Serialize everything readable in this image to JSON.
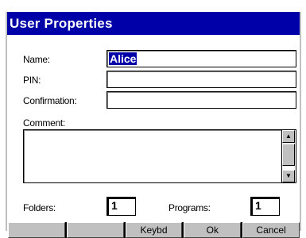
{
  "window": {
    "title": "User Properties"
  },
  "form": {
    "name_label": "Name:",
    "name_value": "Alice",
    "pin_label": "PIN:",
    "pin_value": "",
    "confirmation_label": "Confirmation:",
    "confirmation_value": "",
    "comment_label": "Comment:",
    "comment_value": "",
    "folders_label": "Folders:",
    "folders_value": "1",
    "programs_label": "Programs:",
    "programs_value": "1"
  },
  "scrollbar": {
    "up_icon": "▲",
    "down_icon": "▼"
  },
  "softkeys": [
    "",
    "",
    "Keybd",
    "Ok",
    "Cancel"
  ]
}
